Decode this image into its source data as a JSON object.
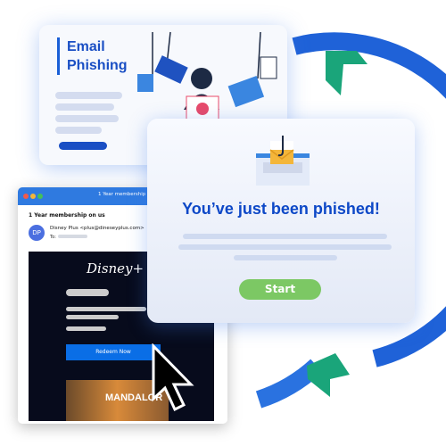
{
  "phishing_card": {
    "title_line1": "Email",
    "title_line2": "Phishing"
  },
  "email_window": {
    "window_title": "1 Year membership on us",
    "subject": "1 Year membership on us",
    "avatar_initials": "DP",
    "from": "Disney Plus <plus@dineseyplus.com>",
    "to_label": "To:",
    "brand": "Disney+",
    "cta": "Redeem Now",
    "poster_text": "MANDALOR"
  },
  "alert_card": {
    "headline": "You’ve just been phished!",
    "button": "Start"
  },
  "colors": {
    "ring": "#1f62d8",
    "arrow": "#1aa57a",
    "headline": "#0d48c7",
    "start": "#7cc864",
    "redeem": "#0a6ee6"
  }
}
